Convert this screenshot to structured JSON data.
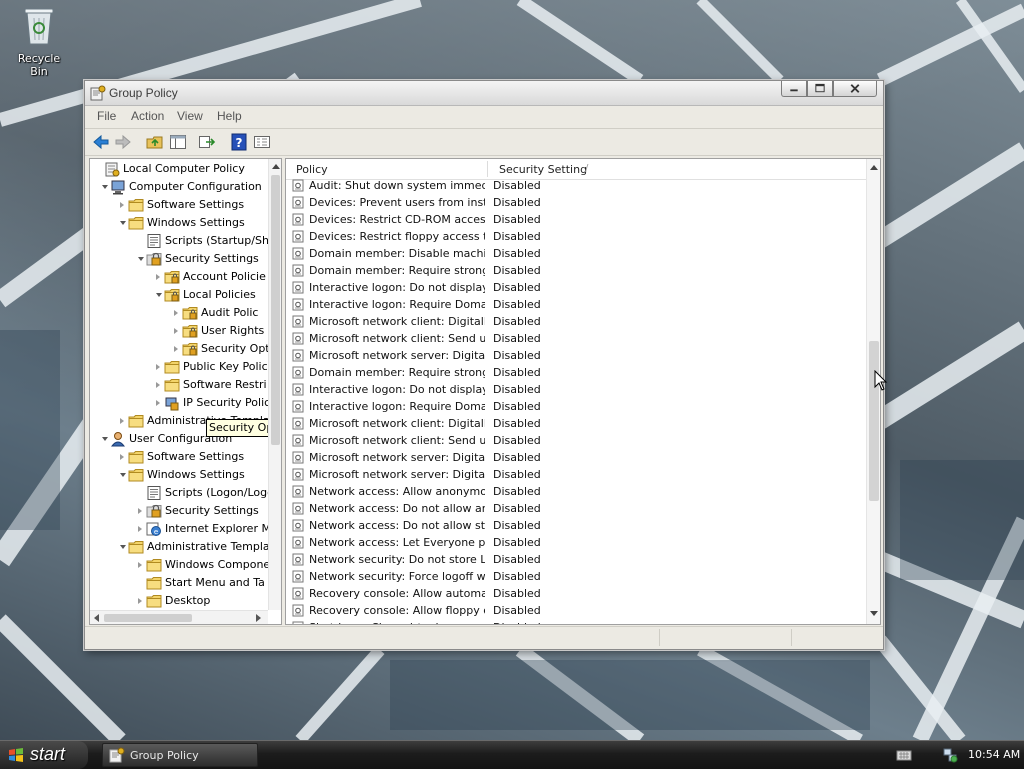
{
  "desktop": {
    "icons": [
      {
        "label": "Recycle Bin",
        "icon": "recycle-bin-icon"
      }
    ]
  },
  "window": {
    "title": "Group Policy",
    "menu": [
      "File",
      "Action",
      "View",
      "Help"
    ],
    "toolbar": [
      "back-icon",
      "forward-icon",
      "up-folder-icon",
      "show-hide-tree-icon",
      "export-list-icon",
      "help-icon",
      "properties-icon"
    ]
  },
  "tree": {
    "items": [
      {
        "label": "Local Computer Policy",
        "icon": "policy-icon",
        "expander": "none"
      },
      {
        "label": "Computer Configuration",
        "icon": "computer-icon",
        "expander": "open"
      },
      {
        "label": "Software Settings",
        "icon": "folder-icon",
        "expander": "closed"
      },
      {
        "label": "Windows Settings",
        "icon": "folder-icon",
        "expander": "open"
      },
      {
        "label": "Scripts (Startup/Shu",
        "icon": "script-icon",
        "expander": "none"
      },
      {
        "label": "Security Settings",
        "icon": "security-icon",
        "expander": "open"
      },
      {
        "label": "Account Policie",
        "icon": "secure-folder-icon",
        "expander": "closed"
      },
      {
        "label": "Local Policies",
        "icon": "secure-folder-icon",
        "expander": "open"
      },
      {
        "label": "Audit Polic",
        "icon": "secure-folder-icon",
        "expander": "closed"
      },
      {
        "label": "User Rights",
        "icon": "secure-folder-icon",
        "expander": "closed"
      },
      {
        "label": "Security Options",
        "icon": "secure-folder-icon",
        "expander": "closed"
      },
      {
        "label": "Public Key Polic",
        "icon": "folder-icon",
        "expander": "closed"
      },
      {
        "label": "Software Restri",
        "icon": "folder-icon",
        "expander": "closed"
      },
      {
        "label": "IP Security Polic",
        "icon": "ip-security-icon",
        "expander": "closed"
      },
      {
        "label": "Administrative Templat",
        "icon": "folder-icon",
        "expander": "closed"
      },
      {
        "label": "User Configuration",
        "icon": "user-icon",
        "expander": "open"
      },
      {
        "label": "Software Settings",
        "icon": "folder-icon",
        "expander": "closed"
      },
      {
        "label": "Windows Settings",
        "icon": "folder-icon",
        "expander": "open"
      },
      {
        "label": "Scripts (Logon/Logo",
        "icon": "script-icon",
        "expander": "none"
      },
      {
        "label": "Security Settings",
        "icon": "security-icon",
        "expander": "closed"
      },
      {
        "label": "Internet Explorer M",
        "icon": "ie-maintenance-icon",
        "expander": "closed"
      },
      {
        "label": "Administrative Templat",
        "icon": "folder-icon",
        "expander": "open"
      },
      {
        "label": "Windows Compone",
        "icon": "folder-icon",
        "expander": "closed"
      },
      {
        "label": "Start Menu and Ta",
        "icon": "folder-icon",
        "expander": "none"
      },
      {
        "label": "Desktop",
        "icon": "folder-icon",
        "expander": "closed"
      }
    ],
    "tooltip": "Security Options"
  },
  "list": {
    "columns": {
      "policy": "Policy",
      "setting": "Security Setting",
      "sort_indicator": "/"
    },
    "rows": [
      {
        "policy": "Audit: Shut down system immediat...",
        "setting": "Disabled"
      },
      {
        "policy": "Devices: Prevent users from installi...",
        "setting": "Disabled"
      },
      {
        "policy": "Devices: Restrict CD-ROM access to...",
        "setting": "Disabled"
      },
      {
        "policy": "Devices: Restrict floppy access to lo...",
        "setting": "Disabled"
      },
      {
        "policy": "Domain member: Disable machine ...",
        "setting": "Disabled"
      },
      {
        "policy": "Domain member: Require strong (...",
        "setting": "Disabled"
      },
      {
        "policy": "Interactive logon: Do not display la...",
        "setting": "Disabled"
      },
      {
        "policy": "Interactive logon: Require Domain ...",
        "setting": "Disabled"
      },
      {
        "policy": "Microsoft network client: Digitally s...",
        "setting": "Disabled"
      },
      {
        "policy": "Microsoft network client: Send une...",
        "setting": "Disabled"
      },
      {
        "policy": "Microsoft network server: Digitally ...",
        "setting": "Disabled"
      },
      {
        "policy": "Domain member: Require strong (...",
        "setting": "Disabled"
      },
      {
        "policy": "Interactive logon: Do not display la...",
        "setting": "Disabled"
      },
      {
        "policy": "Interactive logon: Require Domain ...",
        "setting": "Disabled"
      },
      {
        "policy": "Microsoft network client: Digitally s...",
        "setting": "Disabled"
      },
      {
        "policy": "Microsoft network client: Send une...",
        "setting": "Disabled"
      },
      {
        "policy": "Microsoft network server: Digitally ...",
        "setting": "Disabled"
      },
      {
        "policy": "Microsoft network server: Digitally ...",
        "setting": "Disabled"
      },
      {
        "policy": "Network access: Allow anonymous ...",
        "setting": "Disabled"
      },
      {
        "policy": "Network access: Do not allow anon...",
        "setting": "Disabled"
      },
      {
        "policy": "Network access: Do not allow stora...",
        "setting": "Disabled"
      },
      {
        "policy": "Network access: Let Everyone perm...",
        "setting": "Disabled"
      },
      {
        "policy": "Network security: Do not store LAN...",
        "setting": "Disabled"
      },
      {
        "policy": "Network security: Force logoff whe...",
        "setting": "Disabled"
      },
      {
        "policy": "Recovery console: Allow automatic ...",
        "setting": "Disabled"
      },
      {
        "policy": "Recovery console: Allow floppy cop...",
        "setting": "Disabled"
      },
      {
        "policy": "Shutdown: Clear virtual memory pa...",
        "setting": "Disabled"
      }
    ]
  },
  "taskbar": {
    "start_label": "start",
    "tasks": [
      {
        "label": "Group Policy",
        "icon": "group-policy-icon"
      }
    ],
    "tray_icons": [
      "keyboard-icon",
      "network-icon"
    ],
    "clock": "10:54 AM"
  },
  "colors": {
    "titlebar": "#dcdcdc",
    "window_bg": "#eceae3",
    "tooltip_bg": "#ffffe1",
    "taskbar": "#1c1c1c"
  }
}
